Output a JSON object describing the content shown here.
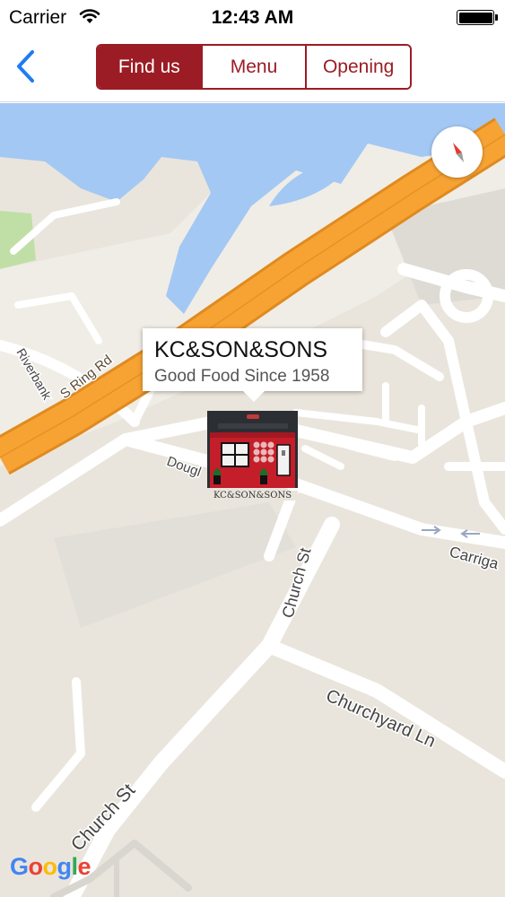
{
  "status_bar": {
    "carrier": "Carrier",
    "time": "12:43 AM"
  },
  "nav": {
    "tabs": [
      {
        "label": "Find us",
        "active": true
      },
      {
        "label": "Menu",
        "active": false
      },
      {
        "label": "Opening",
        "active": false
      }
    ],
    "accent_color": "#9b1c24"
  },
  "map": {
    "info_window": {
      "title": "KC&SON&SONS",
      "subtitle": "Good Food Since 1958"
    },
    "marker_caption": "KC&SON&SONS",
    "street_labels": {
      "riverbank": "Riverbank",
      "s_ring_rd": "S Ring Rd",
      "douglas": "Dougl",
      "church_st_north": "Church St",
      "carrigaline": "Carriga",
      "churchyard_ln": "Churchyard Ln",
      "church_st_south": "Church St"
    },
    "attribution": [
      "G",
      "o",
      "o",
      "g",
      "l",
      "e"
    ],
    "colors": {
      "land": "#e9e5dc",
      "water": "#a3c8f3",
      "highway": "#f6a334",
      "road": "#ffffff",
      "park": "#c0dfa6"
    }
  }
}
